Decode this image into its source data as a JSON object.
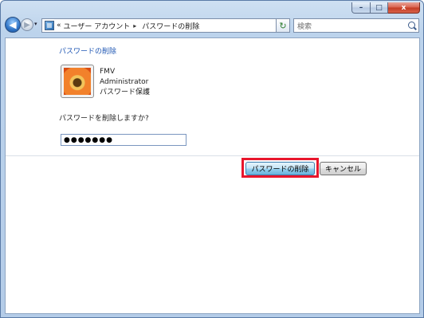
{
  "window": {
    "caption": {
      "minimize": "–",
      "maximize": "□",
      "close": "x"
    }
  },
  "nav": {
    "back_glyph": "◀",
    "forward_glyph": "▶",
    "dropdown_glyph": "▾",
    "refresh_glyph": "↻",
    "address": {
      "prefix": "«",
      "crumbs": [
        "ユーザー アカウント",
        "パスワードの削除"
      ],
      "separator": "▸"
    },
    "search_placeholder": "検索"
  },
  "content": {
    "heading": "パスワードの削除",
    "user": {
      "name": "FMV",
      "role": "Administrator",
      "status": "パスワード保護"
    },
    "prompt": "パスワードを削除しますか?",
    "password_value": "●●●●●●●",
    "buttons": {
      "delete": "パスワードの削除",
      "cancel": "キャンセル"
    }
  },
  "colors": {
    "heading": "#1e56b3",
    "highlight": "#e8162c",
    "window_frame": "#b4cce8"
  }
}
